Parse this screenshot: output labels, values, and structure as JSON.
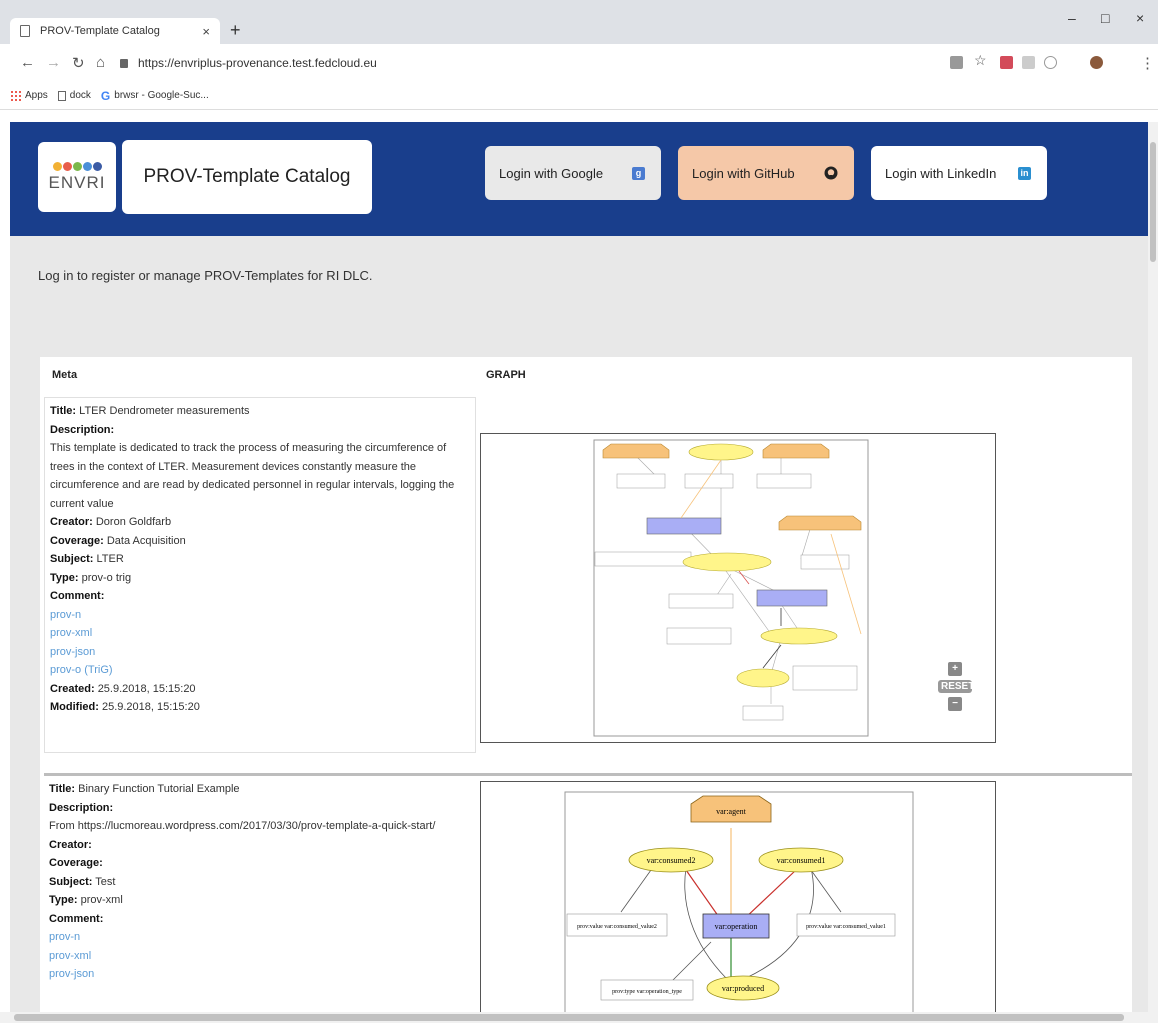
{
  "browser": {
    "tab_title": "PROV-Template Catalog",
    "tab_close": "×",
    "new_tab": "+",
    "url": "https://envriplus-provenance.test.fedcloud.eu",
    "bookmarks": [
      {
        "label": "Apps",
        "icon": "apps-grid-icon"
      },
      {
        "label": "dock",
        "icon": "page-icon"
      },
      {
        "label": "brwsr - Google-Suc...",
        "icon": "google-icon"
      }
    ],
    "window_controls": [
      "–",
      "□",
      "×"
    ]
  },
  "header": {
    "logo_text": "ENVRI",
    "logo_dot_colors": [
      "#f2b134",
      "#e85d4a",
      "#7bb84a",
      "#4a8fd8",
      "#3b5ba5"
    ],
    "site_title": "PROV-Template Catalog",
    "login_google": "Login with Google",
    "login_github": "Login with GitHub",
    "login_linkedin": "Login with LinkedIn",
    "google_icon_letter": "g",
    "linkedin_icon_letter": "in",
    "colors": {
      "header_bg": "#193e8c",
      "github_btn": "#f5c8a8",
      "google_btn": "#e9e9e9",
      "linkedin_btn": "#ffffff"
    }
  },
  "intro_text": "Log in to register or manage PROV-Templates for RI DLC.",
  "table": {
    "meta_header": "Meta",
    "graph_header": "GRAPH",
    "labels": {
      "title": "Title:",
      "description": "Description:",
      "creator": "Creator:",
      "coverage": "Coverage:",
      "subject": "Subject:",
      "type": "Type:",
      "comment": "Comment:",
      "created": "Created:",
      "modified": "Modified:"
    },
    "rows": [
      {
        "title": "LTER Dendrometer measurements",
        "description": "This template is dedicated to track the process of measuring the circumference of trees in the context of LTER. Measurement devices constantly measure the circumference and are read by dedicated personnel in regular intervals, logging the current value",
        "creator": "Doron Goldfarb",
        "coverage": "Data Acquisition",
        "subject": "LTER",
        "type": "prov-o trig",
        "links": [
          "prov-n",
          "prov-xml",
          "prov-json",
          "prov-o (TriG)"
        ],
        "created": "25.9.2018, 15:15:20",
        "modified": "25.9.2018, 15:15:20"
      },
      {
        "title": "Binary Function Tutorial Example",
        "description": "From https://lucmoreau.wordpress.com/2017/03/30/prov-template-a-quick-start/",
        "creator": "",
        "coverage": "",
        "subject": "Test",
        "type": "prov-xml",
        "links": [
          "prov-n",
          "prov-xml",
          "prov-json"
        ]
      }
    ],
    "graph_controls": {
      "zoom_in": "+",
      "reset": "RESET",
      "zoom_out": "−"
    },
    "graph2_nodes": {
      "agent": "var:agent",
      "consumed2": "var:consumed2",
      "consumed1": "var:consumed1",
      "operation": "var:operation",
      "produced": "var:produced",
      "note_left": "prov:value  var:consumed_value2",
      "note_right": "prov:value  var:consumed_value1",
      "note_bottom": "prov:type  var:operation_type"
    }
  }
}
